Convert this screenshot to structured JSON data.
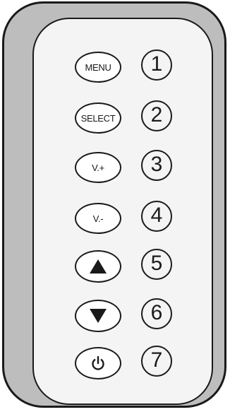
{
  "colors": {
    "outline": "#1a1a1a",
    "outer_shell": "#bdbdbd",
    "inner_panel": "#f4f4f4",
    "button_fill": "#ffffff"
  },
  "buttons": [
    {
      "label": "MENU",
      "icon": "",
      "number": "1"
    },
    {
      "label": "SELECT",
      "icon": "",
      "number": "2"
    },
    {
      "label": "V.+",
      "icon": "",
      "number": "3"
    },
    {
      "label": "V.-",
      "icon": "",
      "number": "4"
    },
    {
      "label": "",
      "icon": "up-triangle-icon",
      "number": "5"
    },
    {
      "label": "",
      "icon": "down-triangle-icon",
      "number": "6"
    },
    {
      "label": "",
      "icon": "power-icon",
      "number": "7"
    }
  ]
}
